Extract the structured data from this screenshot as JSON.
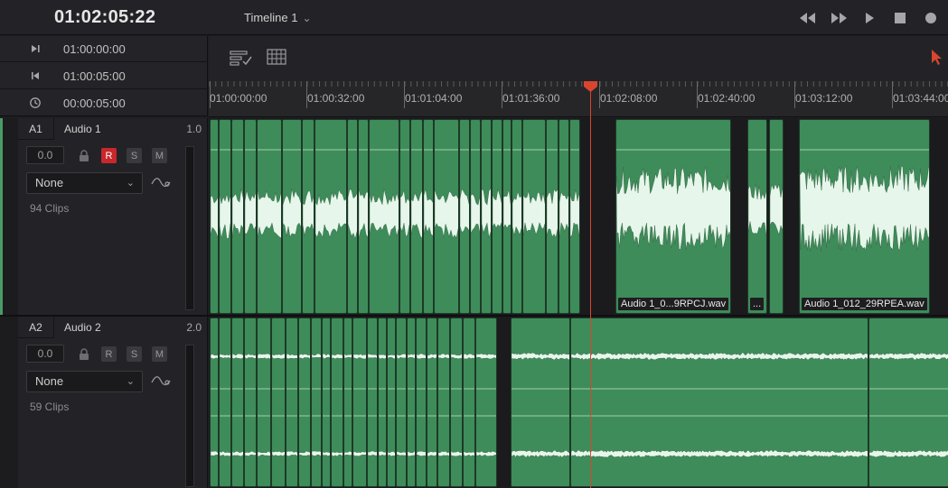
{
  "topbar": {
    "timecode": "01:02:05:22",
    "timeline_name": "Timeline 1",
    "transport": [
      "rewind-icon",
      "fast-forward-icon",
      "play-icon",
      "stop-icon",
      "record-icon"
    ]
  },
  "info": {
    "rows": [
      {
        "icon": "in-point-icon",
        "value": "01:00:00:00"
      },
      {
        "icon": "out-point-icon",
        "value": "01:00:05:00"
      },
      {
        "icon": "duration-clock-icon",
        "value": "00:00:05:00"
      }
    ]
  },
  "toolbar": {
    "tools": [
      "timeline-view-options-icon",
      "grid-icon"
    ],
    "cursor_icon": "selection-pointer-icon",
    "accent_color": "#d9452f"
  },
  "ruler": {
    "labels": [
      "01:00:00:00",
      "01:00:32:00",
      "01:01:04:00",
      "01:01:36:00",
      "01:02:08:00",
      "01:02:40:00",
      "01:03:12:00",
      "01:03:44:00"
    ]
  },
  "tracks": [
    {
      "id": "A1",
      "name": "Audio 1",
      "channels": "1.0",
      "volume": "0.0",
      "buttons": {
        "r": "R",
        "s": "S",
        "m": "M"
      },
      "effect": "None",
      "clip_count": "94 Clips",
      "clip_labels": [
        "Audio 1_0...9RPCJ.wav",
        "...",
        "Audio 1_012_29RPEA.wav"
      ]
    },
    {
      "id": "A2",
      "name": "Audio 2",
      "channels": "2.0",
      "volume": "0.0",
      "buttons": {
        "r": "R",
        "s": "S",
        "m": "M"
      },
      "effect": "None",
      "clip_count": "59 Clips"
    }
  ],
  "colors": {
    "clip_green": "#3e8c5a",
    "waveform": "#e6f6ea",
    "record_active": "#c8272b",
    "playhead": "#d9452f"
  }
}
